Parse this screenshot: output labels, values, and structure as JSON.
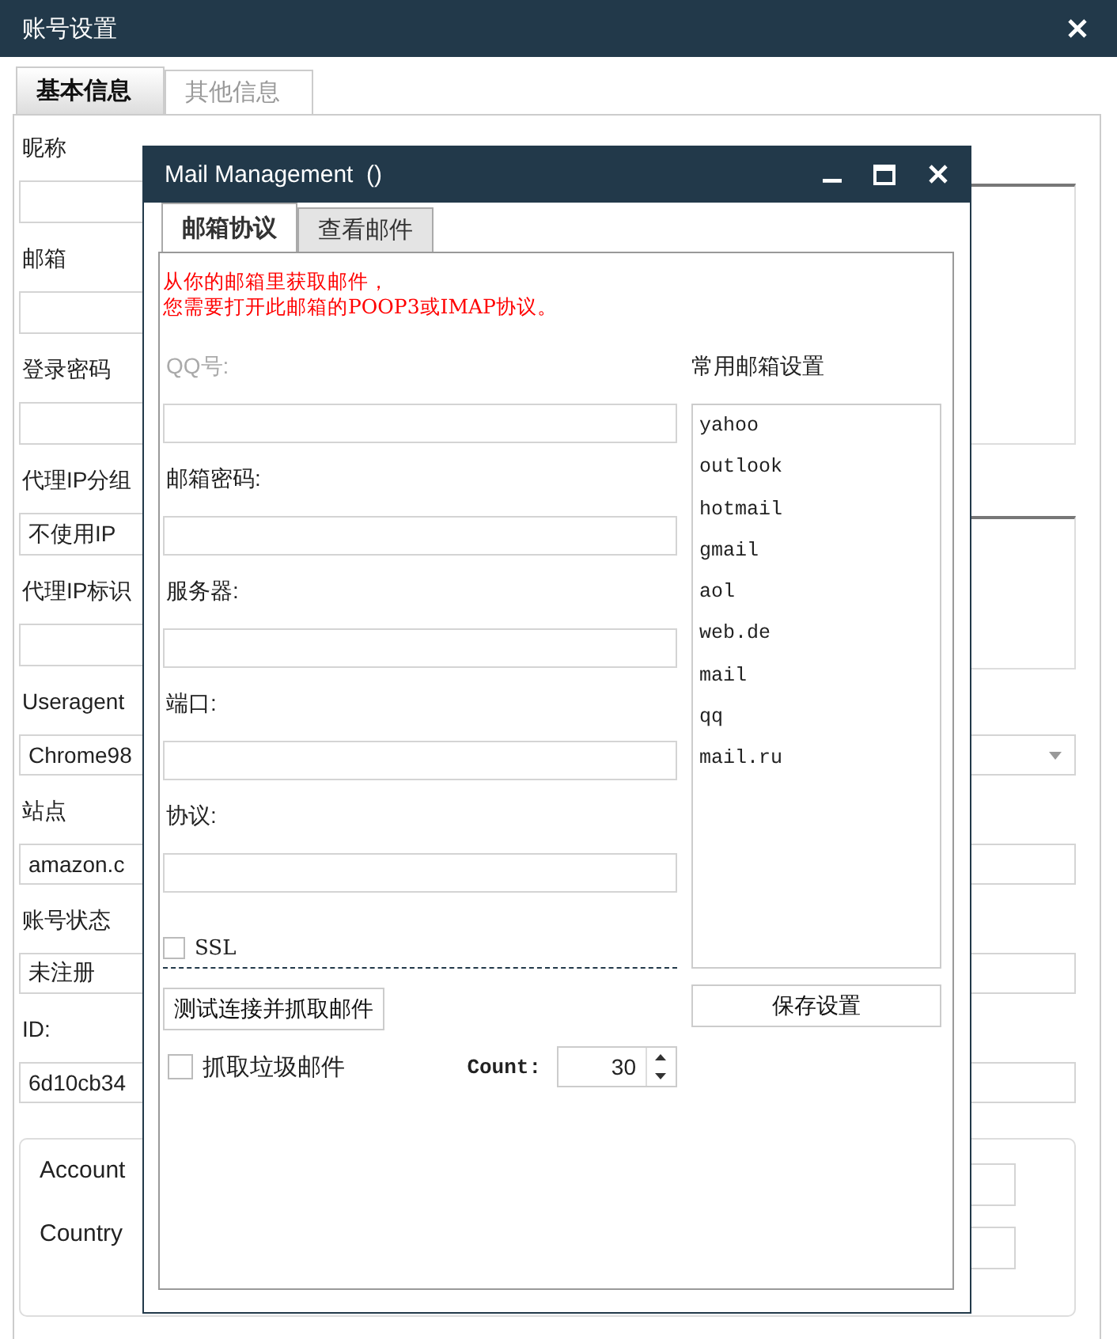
{
  "window": {
    "title": "账号设置"
  },
  "tabs": [
    {
      "label": "基本信息",
      "selected": true
    },
    {
      "label": "其他信息",
      "selected": false
    }
  ],
  "form": {
    "fields": [
      {
        "label": "昵称"
      },
      {
        "label": "邮箱"
      },
      {
        "label": "登录密码"
      },
      {
        "label": "代理IP分组",
        "value": "不使用IP"
      },
      {
        "label": "代理IP标识"
      }
    ],
    "wide_fields": [
      {
        "label": "Useragent",
        "kind": "select",
        "value": "Chrome98"
      },
      {
        "label": "站点",
        "kind": "text",
        "value": "amazon.c"
      },
      {
        "label": "账号状态",
        "kind": "text",
        "value": "未注册"
      },
      {
        "label": "ID:",
        "kind": "text",
        "value": "6d10cb34"
      }
    ],
    "group_fields": [
      {
        "label": "Account"
      },
      {
        "label": "Country"
      }
    ]
  },
  "mail_dialog": {
    "title": "Mail Management  ()",
    "tabs": [
      {
        "label": "邮箱协议",
        "selected": true
      },
      {
        "label": "查看邮件",
        "selected": false
      }
    ],
    "notice_lines": [
      "从你的邮箱里获取邮件，",
      "您需要打开此邮箱的POOP3或IMAP协议。"
    ],
    "fields": [
      {
        "label": "QQ号:",
        "disabled": true
      },
      {
        "label": "邮箱密码:",
        "disabled": false
      },
      {
        "label": "服务器:",
        "disabled": false
      },
      {
        "label": "端口:",
        "disabled": false
      },
      {
        "label": "协议:",
        "disabled": false
      }
    ],
    "ssl": {
      "label": "SSL",
      "checked": false
    },
    "test_button": "测试连接并抓取邮件",
    "junk": {
      "label": "抓取垃圾邮件",
      "checked": false
    },
    "count": {
      "label": "Count:",
      "value": "30"
    },
    "presets": {
      "title": "常用邮箱设置",
      "items": [
        "yahoo",
        "outlook",
        "hotmail",
        "gmail",
        "aol",
        "web.de",
        "mail",
        "qq",
        "mail.ru"
      ]
    },
    "save_button": "保存设置"
  }
}
